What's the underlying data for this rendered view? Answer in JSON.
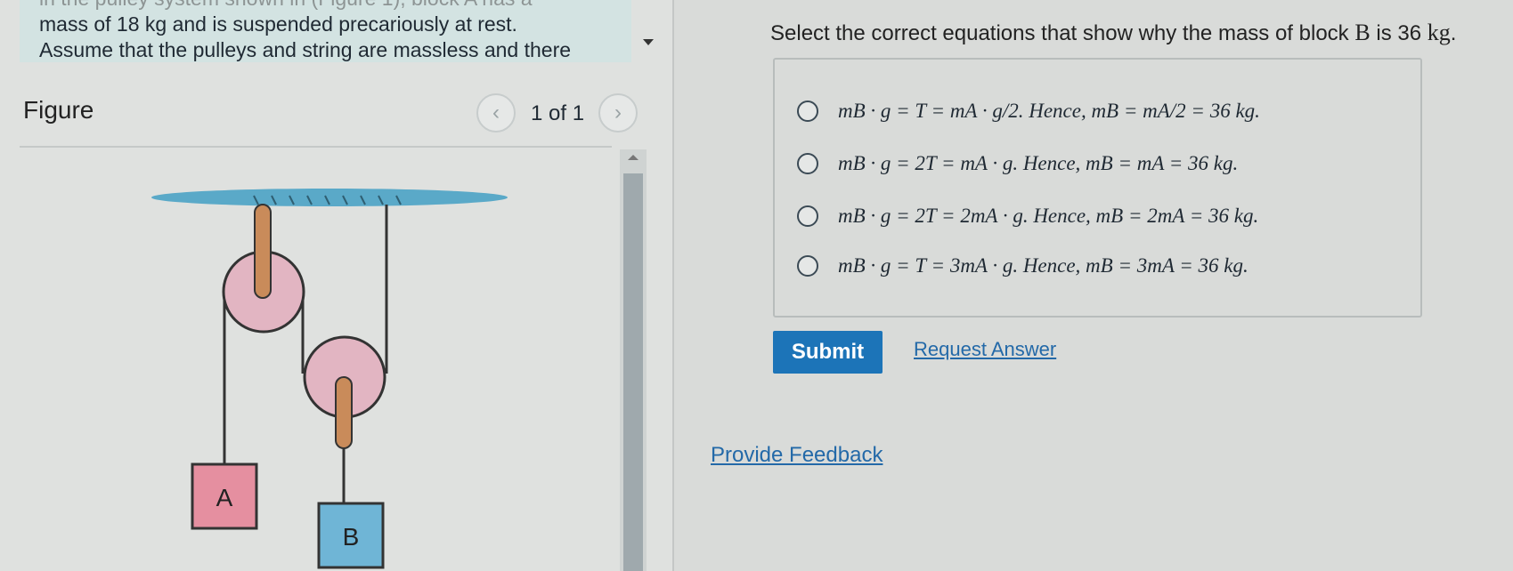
{
  "problem": {
    "cut_line": "in the pulley system shown in (Figure 1), block A has a",
    "line1": "mass of 18 kg and is suspended precariously at rest.",
    "line2": "Assume that the pulleys and string are massless and there"
  },
  "figure": {
    "label": "Figure",
    "page_indicator": "1 of 1",
    "prev_icon": "‹",
    "next_icon": "›",
    "block_a_label": "A",
    "block_b_label": "B",
    "colors": {
      "ceiling": "#5aa9c8",
      "pulley": "#e2b5c2",
      "block_a": "#e58fa0",
      "block_b": "#6fb5d6",
      "hook": "#c98b5a"
    }
  },
  "question": {
    "prefix": "Select the correct equations that show why the mass of block ",
    "block": "B",
    "middle": " is 36 ",
    "unit": "kg",
    "suffix": "."
  },
  "options": [
    {
      "label": "mB · g = T = mA · g/2. Hence, mB = mA/2 = 36 kg."
    },
    {
      "label": "mB · g = 2T = mA · g. Hence, mB = mA = 36 kg."
    },
    {
      "label": "mB · g = 2T = 2mA · g. Hence, mB = 2mA = 36 kg."
    },
    {
      "label": "mB · g = T = 3mA · g. Hence, mB = 3mA = 36 kg."
    }
  ],
  "actions": {
    "submit": "Submit",
    "request_answer": "Request Answer",
    "provide_feedback": "Provide Feedback"
  },
  "colors": {
    "accent": "#1c74b8",
    "link": "#2369a8"
  }
}
